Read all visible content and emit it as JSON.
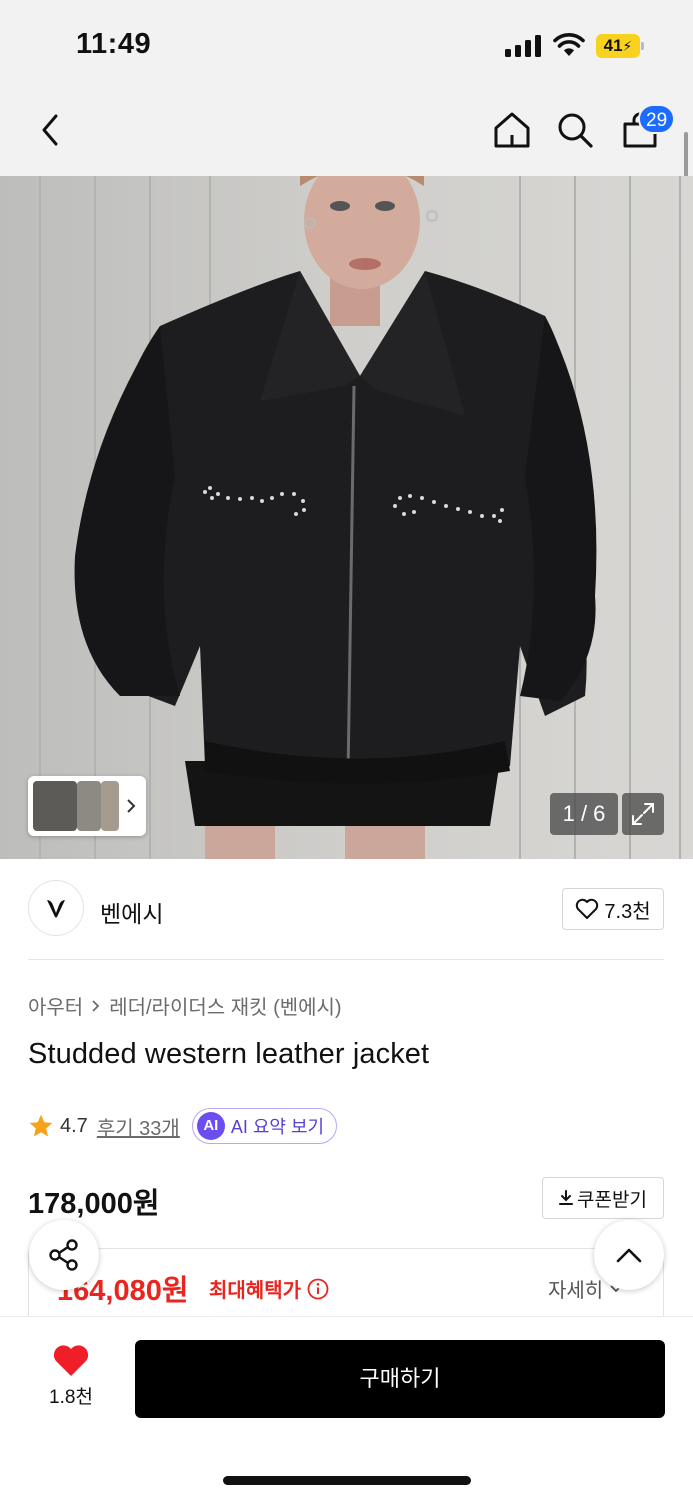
{
  "status_bar": {
    "time": "11:49",
    "battery": "41"
  },
  "nav": {
    "back_icon": "chevron-left-icon",
    "home_icon": "home-icon",
    "search_icon": "search-icon",
    "cart_icon": "shopping-bag-icon",
    "cart_count": "29"
  },
  "gallery": {
    "counter": "1 / 6",
    "expand_icon": "expand-icon"
  },
  "brand": {
    "name": "벤에시",
    "like_count": "7.3천"
  },
  "breadcrumb": {
    "category": "아우터",
    "subcategory": "레더/라이더스 재킷 (벤에시)"
  },
  "product": {
    "title": "Studded western leather jacket",
    "rating": "4.7",
    "review_link": "후기 33개",
    "ai_badge": "AI",
    "ai_summary": "AI 요약 보기",
    "price": "178,000원",
    "coupon_label": "쿠폰받기"
  },
  "benefit": {
    "price": "164,080원",
    "label": "최대혜택가",
    "detail_label": "자세히"
  },
  "bottom_bar": {
    "wish_count": "1.8천",
    "buy_label": "구매하기"
  },
  "colors": {
    "accent_blue": "#1e6bff",
    "sale_red": "#e8261f",
    "ai_purple": "#6a4ef0"
  }
}
